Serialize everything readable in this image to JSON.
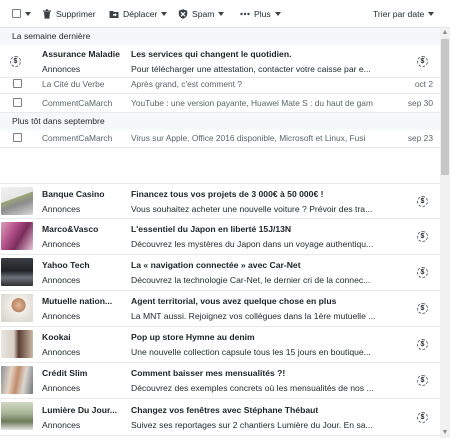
{
  "toolbar": {
    "delete_label": "Supprimer",
    "move_label": "Déplacer",
    "spam_label": "Spam",
    "more_label": "Plus",
    "sort_label": "Trier par date"
  },
  "sections": [
    {
      "label": "La semaine dernière"
    },
    {
      "label": "Plus tôt dans septembre"
    }
  ],
  "sponsored_icon": "$",
  "assurance": {
    "sender": "Assurance Maladie",
    "tag": "Annonces",
    "subject": "Les services qui changent le quotidien.",
    "snippet": "Pour télécharger une attestation, contacter votre caisse par e..."
  },
  "small_rows": [
    {
      "sender": "La Cité du Verbe",
      "subject": "Après grand, c'est comment ?",
      "date": "oct 2"
    },
    {
      "sender": "CommentCaMarch",
      "subject": "YouTube : une version payante, Huawei Mate S : du haut de gam",
      "date": "sep 30"
    },
    {
      "sender": "CommentCaMarch",
      "subject": "Virus sur Apple, Office 2016 disponible, Microsoft et Linux, Fusi",
      "date": "sep 23"
    }
  ],
  "ads": [
    {
      "sender": "Banque Casino",
      "tag": "Annonces",
      "subject": "Financez tous vos projets de 3 000€ à 50 000€ !",
      "snippet": "Vous souhaitez acheter une nouvelle voiture ? Prévoir des tra..."
    },
    {
      "sender": "Marco&Vasco",
      "tag": "Annonces",
      "subject": "L'essentiel du Japon en liberté 15J/13N",
      "snippet": "Découvrez les mystères du Japon dans un voyage authentiqu..."
    },
    {
      "sender": "Yahoo Tech",
      "tag": "Annonces",
      "subject": "La « navigation connectée » avec Car-Net",
      "snippet": "Découvrez la technologie Car-Net, le dernier cri de la connec..."
    },
    {
      "sender": "Mutuelle nation...",
      "tag": "Annonces",
      "subject": "Agent territorial, vous avez quelque chose en plus",
      "snippet": "La MNT aussi. Rejoignez vos collègues dans la 1ère mutuelle ..."
    },
    {
      "sender": "Kookai",
      "tag": "Annonces",
      "subject": "Pop up store Hymne au denim",
      "snippet": "Une nouvelle collection capsule tous les 15 jours en boutique..."
    },
    {
      "sender": "Crédit Slim",
      "tag": "Annonces",
      "subject": "Comment baisser mes mensualités ?!",
      "snippet": "Découvrez des exemples concrets où les mensualités de nos ..."
    },
    {
      "sender": "Lumière Du Jour...",
      "tag": "Annonces",
      "subject": "Changez vos fenêtres avec Stéphane Thébaut",
      "snippet": "Suivez ses reportages sur 2 chantiers Lumière du Jour. En sa..."
    }
  ]
}
